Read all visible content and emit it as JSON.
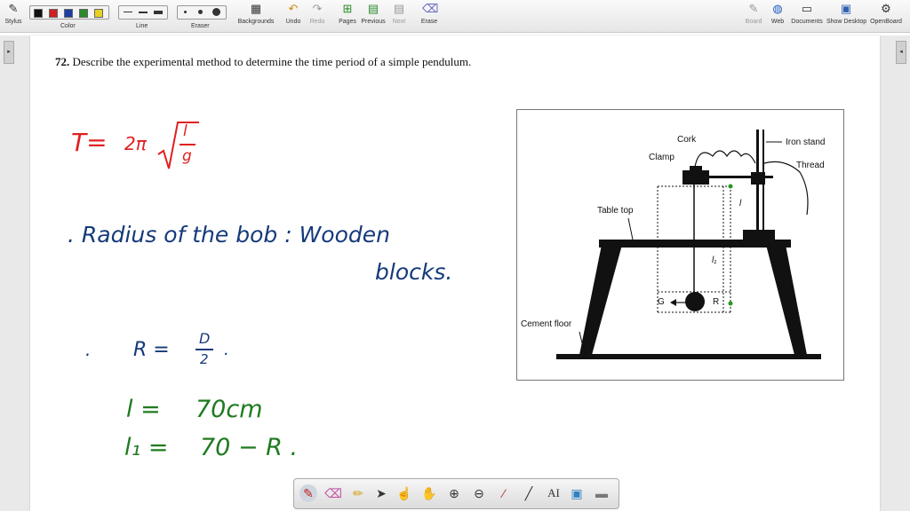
{
  "toolbar": {
    "stylus": "Stylus",
    "color": "Color",
    "line": "Line",
    "eraser": "Eraser",
    "backgrounds": "Backgrounds",
    "undo": "Undo",
    "redo": "Redo",
    "pages": "Pages",
    "previous": "Previous",
    "next": "Next",
    "erase": "Erase",
    "board": "Board",
    "web": "Web",
    "documents": "Documents",
    "show_desktop": "Show Desktop",
    "openboard": "OpenBoard",
    "colors": [
      "#111111",
      "#d12020",
      "#1a3fa8",
      "#2a8a2a",
      "#e8d020"
    ]
  },
  "question": {
    "number": "72.",
    "text": "Describe the experimental method to determine the time period of a simple pendulum."
  },
  "notes": {
    "formula_lhs": "T=",
    "formula_mid": "2π",
    "formula_num": "l",
    "formula_den": "g",
    "radius_line": ". Radius  of   the  bob : Wooden",
    "blocks": "blocks.",
    "dot": ".",
    "r_eq": "R  =",
    "d_num": "D",
    "d_den": "2",
    "r_dot": ".",
    "l_eq": "l  =",
    "l_val": "70cm",
    "l1_eq": "l₁ =",
    "l1_val": "70 − R .",
    "red": "#e02020",
    "blue": "#153a7a",
    "green": "#1f7a1f"
  },
  "figure": {
    "cork": "Cork",
    "iron_stand": "Iron stand",
    "clamp": "Clamp",
    "thread": "Thread",
    "table_top": "Table top",
    "l": "l",
    "l1": "l₁",
    "g_label": "G",
    "r_label": "R",
    "cement_floor": "Cement floor"
  }
}
